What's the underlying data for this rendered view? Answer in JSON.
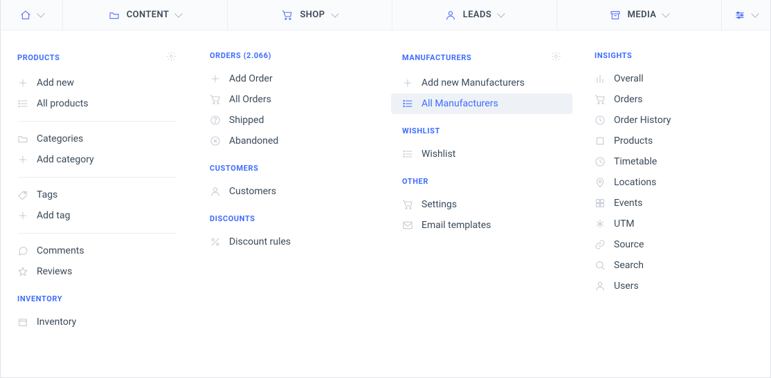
{
  "topnav": [
    {
      "name": "home-tab",
      "icon": "home",
      "label": "",
      "narrow": true
    },
    {
      "name": "content-tab",
      "icon": "folder",
      "label": "CONTENT"
    },
    {
      "name": "shop-tab",
      "icon": "cart",
      "label": "SHOP"
    },
    {
      "name": "leads-tab",
      "icon": "user",
      "label": "LEADS"
    },
    {
      "name": "media-tab",
      "icon": "archive",
      "label": "MEDIA"
    },
    {
      "name": "filter-tab",
      "icon": "sliders",
      "label": "",
      "narrowRight": true
    }
  ],
  "columns": [
    {
      "groups": [
        {
          "title": "PRODUCTS",
          "gear": true,
          "items": [
            {
              "name": "add-new-product",
              "icon": "plus",
              "label": "Add new"
            },
            {
              "name": "all-products",
              "icon": "list",
              "label": "All products"
            },
            {
              "sep": true
            },
            {
              "name": "categories",
              "icon": "folder",
              "label": "Categories"
            },
            {
              "name": "add-category",
              "icon": "plus",
              "label": "Add category"
            },
            {
              "sep": true
            },
            {
              "name": "tags",
              "icon": "tag",
              "label": "Tags"
            },
            {
              "name": "add-tag",
              "icon": "plus",
              "label": "Add tag"
            },
            {
              "sep": true
            },
            {
              "name": "comments",
              "icon": "comment",
              "label": "Comments"
            },
            {
              "name": "reviews",
              "icon": "star",
              "label": "Reviews"
            }
          ]
        },
        {
          "title": "INVENTORY",
          "items": [
            {
              "name": "inventory",
              "icon": "box",
              "label": "Inventory"
            }
          ]
        }
      ]
    },
    {
      "groups": [
        {
          "title": "ORDERS (2.066)",
          "items": [
            {
              "name": "add-order",
              "icon": "plus",
              "label": "Add Order"
            },
            {
              "name": "all-orders",
              "icon": "cart",
              "label": "All Orders"
            },
            {
              "name": "shipped",
              "icon": "help",
              "label": "Shipped"
            },
            {
              "name": "abandoned",
              "icon": "xcircle",
              "label": "Abandoned"
            }
          ]
        },
        {
          "title": "CUSTOMERS",
          "items": [
            {
              "name": "customers",
              "icon": "user",
              "label": "Customers"
            }
          ]
        },
        {
          "title": "DISCOUNTS",
          "items": [
            {
              "name": "discount-rules",
              "icon": "percent",
              "label": "Discount rules"
            }
          ]
        }
      ]
    },
    {
      "groups": [
        {
          "title": "MANUFACTURERS",
          "gear": true,
          "items": [
            {
              "name": "add-manufacturer",
              "icon": "plus",
              "label": "Add new Manufacturers"
            },
            {
              "name": "all-manufacturers",
              "icon": "list",
              "label": "All Manufacturers",
              "active": true
            }
          ]
        },
        {
          "title": "WISHLIST",
          "items": [
            {
              "name": "wishlist",
              "icon": "list",
              "label": "Wishlist"
            }
          ]
        },
        {
          "title": "OTHER",
          "items": [
            {
              "name": "settings",
              "icon": "cart",
              "label": "Settings"
            },
            {
              "name": "email-templates",
              "icon": "mail",
              "label": "Email templates"
            }
          ]
        }
      ]
    },
    {
      "groups": [
        {
          "title": "INSIGHTS",
          "items": [
            {
              "name": "insight-overall",
              "icon": "bars",
              "label": "Overall"
            },
            {
              "name": "insight-orders",
              "icon": "cart",
              "label": "Orders"
            },
            {
              "name": "insight-history",
              "icon": "clock",
              "label": "Order History"
            },
            {
              "name": "insight-products",
              "icon": "square",
              "label": "Products"
            },
            {
              "name": "insight-timetable",
              "icon": "clock",
              "label": "Timetable"
            },
            {
              "name": "insight-locations",
              "icon": "pin",
              "label": "Locations"
            },
            {
              "name": "insight-events",
              "icon": "grid",
              "label": "Events"
            },
            {
              "name": "insight-utm",
              "icon": "asterisk",
              "label": "UTM"
            },
            {
              "name": "insight-source",
              "icon": "link",
              "label": "Source"
            },
            {
              "name": "insight-search",
              "icon": "search",
              "label": "Search"
            },
            {
              "name": "insight-users",
              "icon": "user",
              "label": "Users"
            }
          ]
        }
      ]
    }
  ]
}
